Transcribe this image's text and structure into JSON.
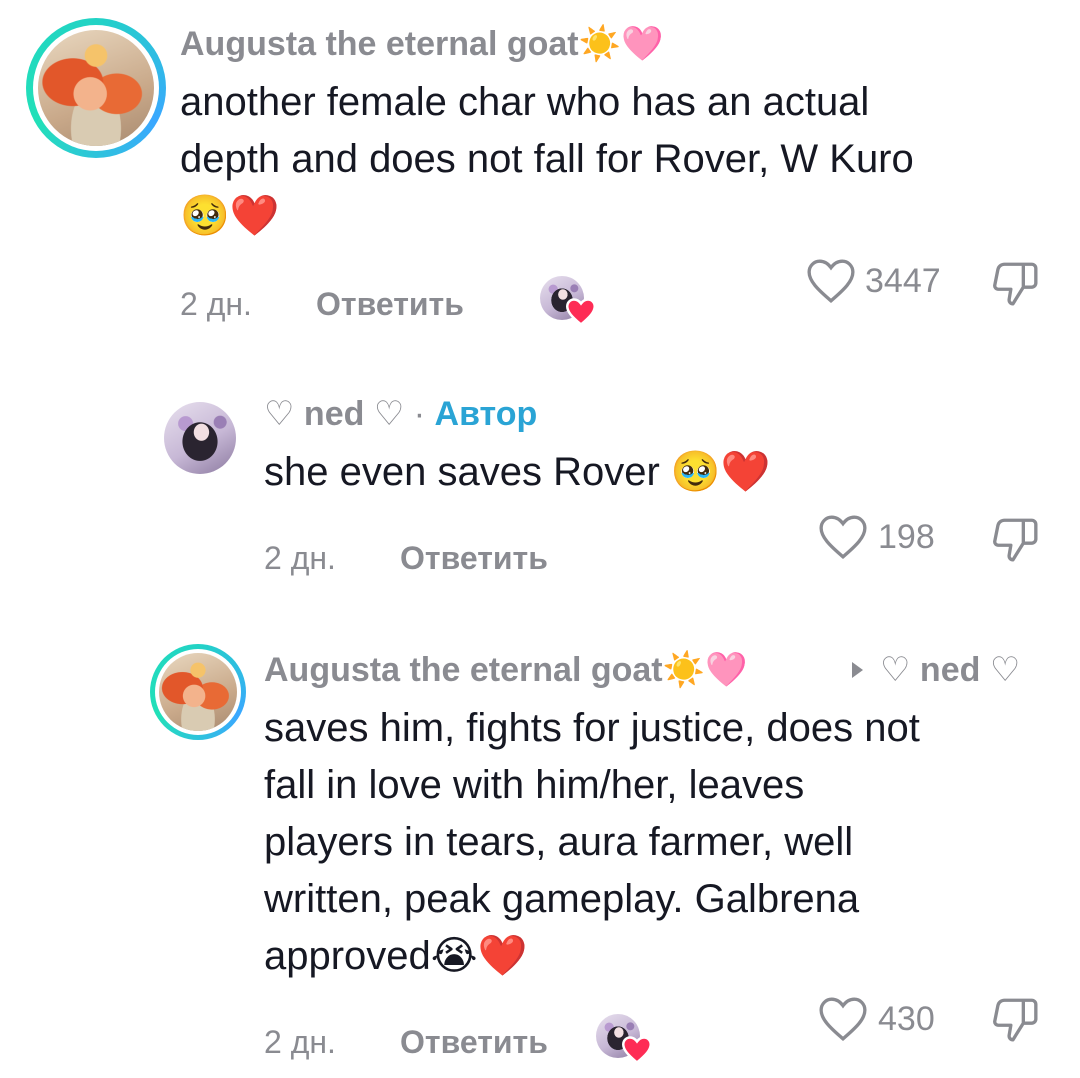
{
  "comments": [
    {
      "username": "Augusta the eternal goat☀️🩷",
      "text_lines": [
        "another female char who has an actual",
        "depth and does not fall for Rover, W Kuro",
        "🥹❤️"
      ],
      "time": "2 дн.",
      "reply_label": "Ответить",
      "likes": "3447"
    },
    {
      "username": "♡ ned ♡",
      "separator": "·",
      "author_tag": "Автор",
      "text": "she even saves Rover 🥹❤️",
      "time": "2 дн.",
      "reply_label": "Ответить",
      "likes": "198"
    },
    {
      "username": "Augusta the eternal goat☀️🩷",
      "reply_to": "♡ ned ♡",
      "text_lines": [
        "saves him, fights for justice, does not",
        "fall in love with him/her, leaves",
        "players in tears, aura farmer, well",
        "written, peak gameplay. Galbrena",
        "approved😭❤️"
      ],
      "time": "2 дн.",
      "reply_label": "Ответить",
      "likes": "430"
    }
  ],
  "colors": {
    "secondary_text": "#8a8b91",
    "author_accent": "#2aa4d5",
    "creator_like_heart": "#fe2c55"
  },
  "icons": [
    "heart-outline-icon",
    "dislike-icon",
    "reply-arrow-icon",
    "creator-liked-heart-icon"
  ]
}
